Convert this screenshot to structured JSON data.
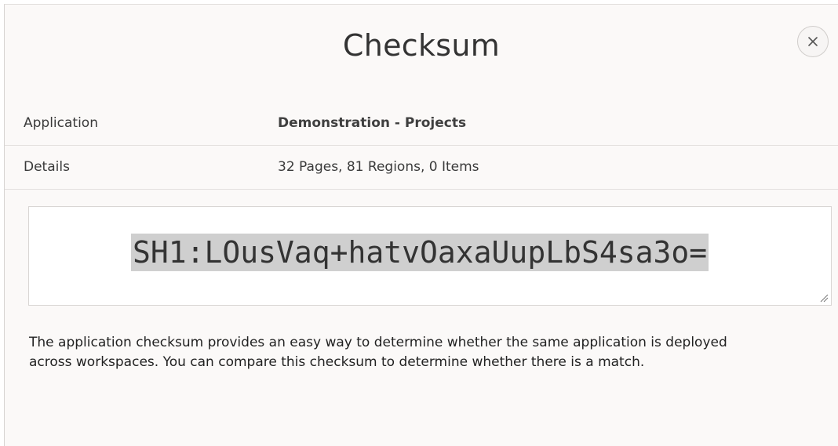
{
  "dialog": {
    "title": "Checksum",
    "close_icon": "close-icon"
  },
  "rows": {
    "application": {
      "label": "Application",
      "value": "Demonstration - Projects"
    },
    "details": {
      "label": "Details",
      "value": "32 Pages, 81 Regions, 0 Items"
    }
  },
  "checksum": {
    "value": "SH1:LOusVaq+hatvOaxaUupLbS4sa3o=",
    "resize_icon": "resize-grip-icon"
  },
  "description": {
    "line1": "The application checksum provides an easy way to determine whether the same application is deployed",
    "line2": "across workspaces. You can compare this checksum to determine whether there is a match."
  },
  "colors": {
    "dialog_background": "#fbf9f8",
    "selection_highlight": "#cfcfcf",
    "text": "#333333"
  }
}
